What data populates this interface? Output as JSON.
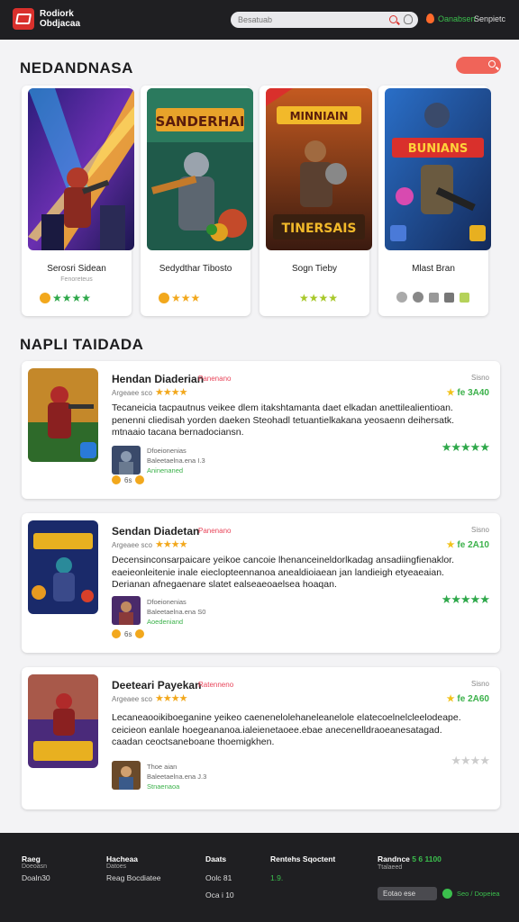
{
  "header": {
    "logo_line1": "Rodiork",
    "logo_line2": "Obdjacaa",
    "search_placeholder": "Besatuab",
    "link1": "Oanabsen",
    "link2": "Senpietc"
  },
  "featured": {
    "title": "NEDANDNASA",
    "cards": [
      {
        "name": "Serosri Sidean",
        "sub": "Fenoreteus",
        "rating": "★★★★"
      },
      {
        "name": "Sedydthar Tibosto",
        "sub": "",
        "rating": "★★★"
      },
      {
        "name": "Sogn Tieby",
        "sub": "",
        "rating": "★★★★"
      },
      {
        "name": "Mlast Bran",
        "sub": "",
        "rating": ""
      }
    ],
    "card_art_titles": [
      "",
      "SANDERHAI",
      "MINNIAIN",
      "BUNIANS"
    ],
    "card_art_subtitles": [
      "",
      "",
      "TINERSAIS",
      ""
    ]
  },
  "reviews_section": {
    "title": "NAPLI TAIDADA",
    "reviews": [
      {
        "title": "Hendan Diaderian",
        "badge": "Panenano",
        "by": "Argeaee sco",
        "stars": "★★★★",
        "date": "Sisno",
        "score": "fe 3A40",
        "body": "Tecaneicia tacpautnus veikee dlem itakshtamanta daet elkadan anettilealientioan. penenni cliedisah yorden daeken Steohadl tetuantielkakana yeosaenn deihersatk. mtnaaio tacana bernadociansn.",
        "green_stars": "★★★★★",
        "meta1": "Dfoeionenias",
        "meta2": "Baleetaelna.ena I.3",
        "meta3": "Aninenaned",
        "actions": "6s"
      },
      {
        "title": "Sendan Diadetan",
        "badge": "Panenano",
        "by": "Argeaee sco",
        "stars": "★★★★",
        "date": "Sisno",
        "score": "fe 2A10",
        "body": "Decensinconsarpaicare yeikoe cancoie lhenanceineldorlkadag ansadiingfienaklor. eaeieonleitenie inale eieclopteennanoa anealdioiaean jan landieigh etyeaeaian. Derianan afnegaenare slatet ealseaeoaelsea hoaqan.",
        "green_stars": "★★★★★",
        "meta1": "Dfoeionenias",
        "meta2": "Baleetaelna.ena S0",
        "meta3": "Aoedeniand",
        "actions": "6s"
      },
      {
        "title": "Deeteari Payekan",
        "badge": "Ratenneno",
        "by": "Argeaee sco",
        "stars": "★★★★",
        "date": "Sisno",
        "score": "fe 2A60",
        "body": "Lecaneaooikiboeganine yeikeo caenenelolehaneleanelole elatecoelnelcleelodeape. ceicieon eanlale hoegeananoa.ialeienetaoee.ebae anecenelldraoeanesatagad. caadan ceoctsaneboane thoemigkhen.",
        "green_stars": "★★★★",
        "meta1": "Thoe aian",
        "meta2": "Baleetaelna.ena J.3",
        "meta3": "Stnaenaoa",
        "actions": ""
      }
    ]
  },
  "footer": {
    "col1_title": "Raeg",
    "col1_sub": "Doeoasn",
    "col1_item": "Doaln30",
    "col2_title": "Hacheaa",
    "col2_sub": "Datoes",
    "col2_item": "Reag Bocdiatee",
    "col3_title": "Daats",
    "col3_item1": "Oolc 81",
    "col3_item2": "Oca i 10",
    "col4_title": "Rentehs Sqoctent",
    "col4_item": "1.9.",
    "col5_title": "Randnce",
    "col5_title_accent": "5 6 1100",
    "col5_sub": "Ttalaeed",
    "newsletter_placeholder": "Eotao ese",
    "col5_item": "Seo / Dopeiea"
  },
  "colors": {
    "accent": "#d9302c",
    "green": "#3bbf4d",
    "star": "#f2a81d"
  }
}
